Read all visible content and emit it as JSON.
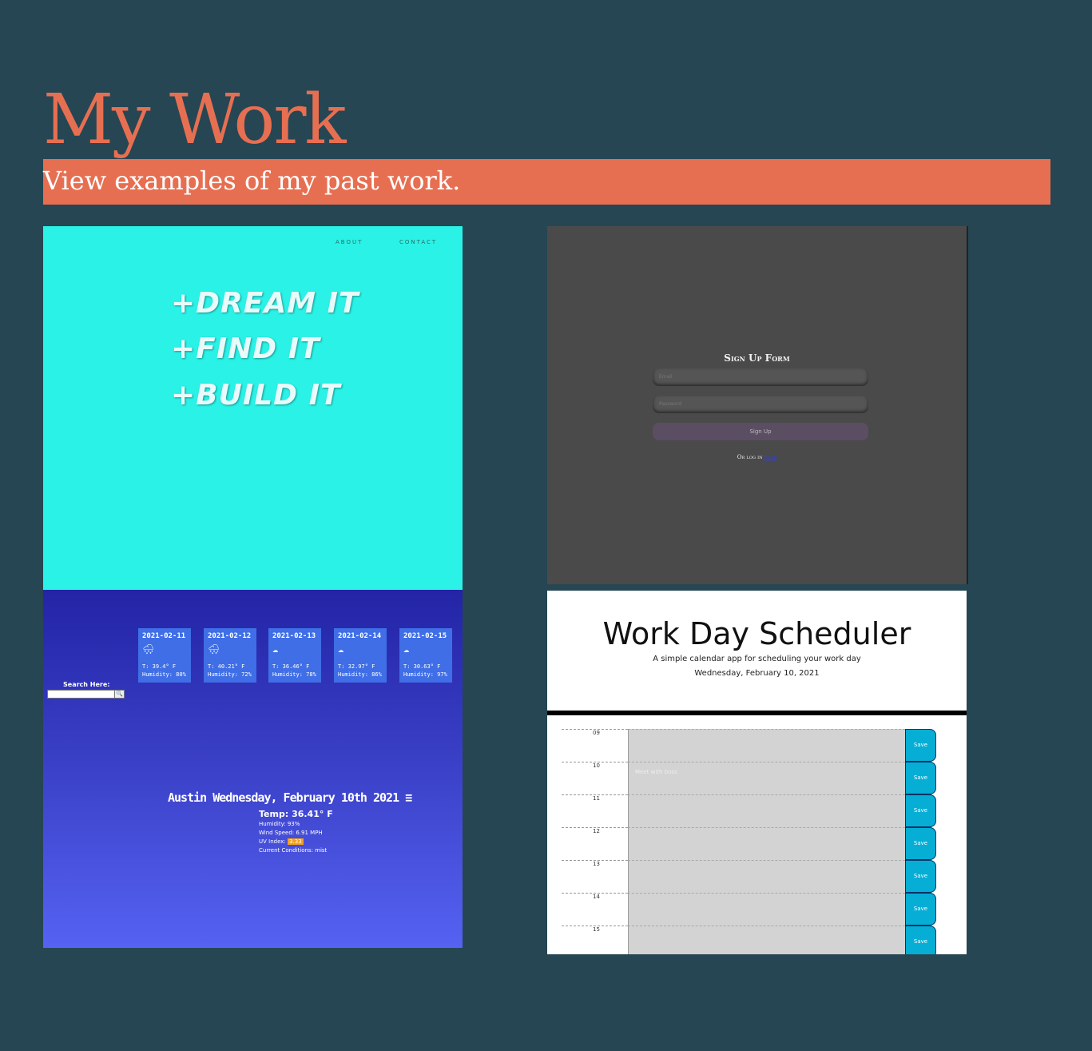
{
  "page": {
    "title": "My Work",
    "subtitle": "View examples of my past work."
  },
  "projects": {
    "landing": {
      "nav": [
        "ABOUT",
        "CONTACT"
      ],
      "lines": [
        "+DREAM IT",
        "+FIND IT",
        "+BUILD IT"
      ]
    },
    "signup": {
      "title": "Sign Up Form",
      "email_placeholder": "Email",
      "password_placeholder": "Password",
      "button": "Sign Up",
      "footer_text": "Or log in",
      "footer_link": "here"
    },
    "weather": {
      "forecast": [
        {
          "date": "2021-02-11",
          "icon": "snow-cloud-icon",
          "temp": "T: 39.4° F",
          "humidity": "Humidity: 80%"
        },
        {
          "date": "2021-02-12",
          "icon": "snow-cloud-icon",
          "temp": "T: 40.21° F",
          "humidity": "Humidity: 72%"
        },
        {
          "date": "2021-02-13",
          "icon": "cloud-icon",
          "temp": "T: 36.46° F",
          "humidity": "Humidity: 78%"
        },
        {
          "date": "2021-02-14",
          "icon": "cloud-icon",
          "temp": "T: 32.97° F",
          "humidity": "Humidity: 86%"
        },
        {
          "date": "2021-02-15",
          "icon": "cloud-icon",
          "temp": "T: 30.63° F",
          "humidity": "Humidity: 97%"
        }
      ],
      "search_label": "Search Here:",
      "city_line": "Austin Wednesday, February 10th 2021",
      "temp": "Temp: 36.41° F",
      "humidity": "Humidity: 93%",
      "wind": "Wind Speed: 6.91 MPH",
      "uv_label": "UV Index:",
      "uv_value": "3.33",
      "conditions": "Current Conditions: mist"
    },
    "scheduler": {
      "title": "Work Day Scheduler",
      "subtitle": "A simple calendar app for scheduling your work day",
      "date": "Wednesday, February 10, 2021",
      "rows": [
        {
          "hour": "09",
          "text": ""
        },
        {
          "hour": "10",
          "text": "Meet with boss"
        },
        {
          "hour": "11",
          "text": ""
        },
        {
          "hour": "12",
          "text": ""
        },
        {
          "hour": "13",
          "text": ""
        },
        {
          "hour": "14",
          "text": ""
        },
        {
          "hour": "15",
          "text": ""
        }
      ],
      "save_label": "Save"
    }
  }
}
